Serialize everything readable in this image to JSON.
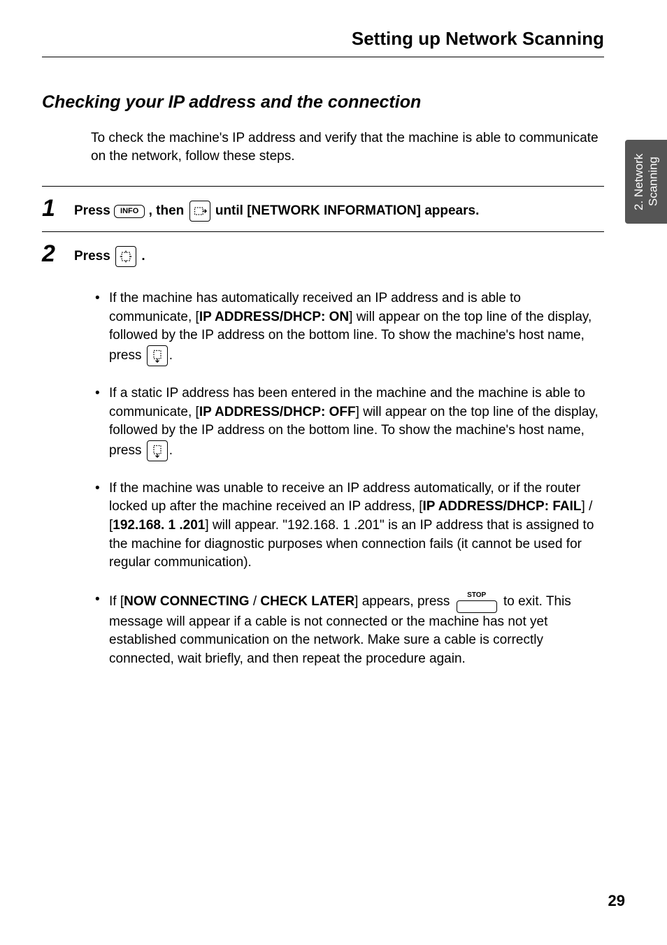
{
  "header": {
    "title": "Setting up Network Scanning"
  },
  "side_tab": "2. Network Scanning",
  "section": {
    "title": "Checking your IP address and the connection",
    "intro": "To check the machine's IP address and verify that the machine is able to communicate on the network, follow these steps."
  },
  "steps": {
    "step1": {
      "num": "1",
      "before": "Press ",
      "info_key": "INFO",
      "mid": ", then ",
      "after": " until [NETWORK INFORMATION] appears."
    },
    "step2": {
      "num": "2",
      "before": "Press ",
      "after": "."
    }
  },
  "bullets": {
    "b1": {
      "t1": "If the machine has automatically received an IP address and is able to communicate, [",
      "bold1": "IP ADDRESS/DHCP: ON",
      "t2": "] will appear on the top line of the display, followed by the IP address on the bottom line. To show the machine's host name, press ",
      "t3": "."
    },
    "b2": {
      "t1": "If a static IP address has been entered in the machine and the machine is able to communicate, [",
      "bold1": "IP ADDRESS/DHCP: OFF",
      "t2": "] will appear on the top line of the display, followed by the IP address on the bottom line. To show the machine's host name, press ",
      "t3": "."
    },
    "b3": {
      "t1": "If the machine was unable to receive an IP address automatically, or if the router locked up after the machine received an IP address, [",
      "bold1": "IP ADDRESS/DHCP: FAIL",
      "t2": "] / [",
      "bold2": "192.168. 1 .201",
      "t3": "] will appear. \"192.168. 1 .201\" is an IP address that is assigned to the machine for diagnostic purposes when connection fails (it cannot be used for regular communication)."
    },
    "b4": {
      "t1": "If [",
      "bold1": "NOW CONNECTING",
      "t2": " / ",
      "bold2": "CHECK LATER",
      "t3": "] appears, press ",
      "stop_label": "STOP",
      "t4": " to exit. This message will appear if a cable is not connected or the machine has not yet established communication on the network. Make sure a cable is correctly connected,  wait briefly, and then repeat the procedure again."
    }
  },
  "page_number": "29"
}
